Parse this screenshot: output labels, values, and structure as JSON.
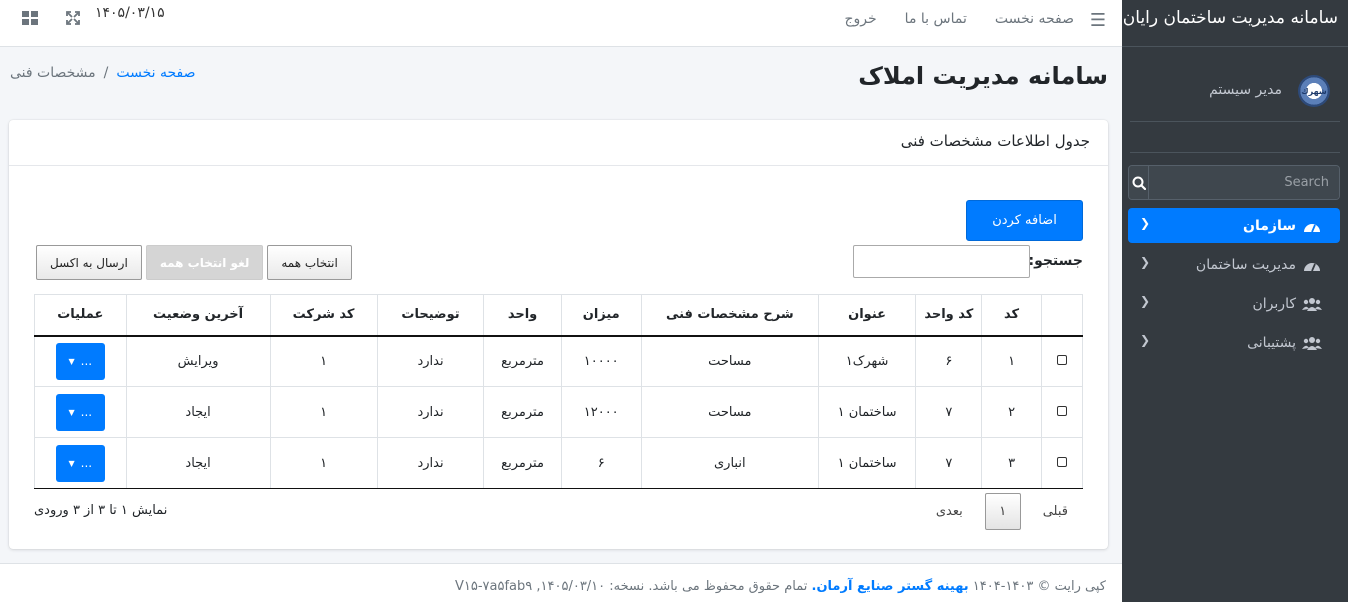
{
  "brand": {
    "title": "سامانه مدیریت ساختمان رایان"
  },
  "user": {
    "name": "مدیر سیستم",
    "avatar_text": "شهرك"
  },
  "sidebar_search": {
    "placeholder": "Search"
  },
  "nav": {
    "items": [
      {
        "label": "سازمان",
        "icon": "dashboard-icon",
        "active": true
      },
      {
        "label": "مدیریت ساختمان",
        "icon": "dashboard-icon",
        "active": false
      },
      {
        "label": "کاربران",
        "icon": "users-icon",
        "active": false
      },
      {
        "label": "پشتیبانی",
        "icon": "users-icon",
        "active": false
      }
    ]
  },
  "topbar": {
    "home": "صفحه نخست",
    "contact": "تماس با ما",
    "logout": "خروج",
    "date": "۱۴۰۵/۰۳/۱۵"
  },
  "page": {
    "title": "سامانه مدیریت املاک",
    "breadcrumb_home": "صفحه نخست",
    "breadcrumb_sep": "/",
    "breadcrumb_current": "مشخصات فنی"
  },
  "card": {
    "title": "جدول اطلاعات مشخصات فنی",
    "add_label": "اضافه کردن",
    "search_label": "جستجو:",
    "buttons": {
      "select_all": "انتخاب همه",
      "deselect_all": "لغو انتخاب همه",
      "excel": "ارسال به اکسل"
    }
  },
  "table": {
    "headers": [
      "",
      "کد",
      "کد واحد",
      "عنوان",
      "شرح مشخصات فنی",
      "میزان",
      "واحد",
      "توضیحات",
      "کد شرکت",
      "آخرین وضعیت",
      "عملیات"
    ],
    "rows": [
      [
        "۱",
        "۶",
        "شهرک۱",
        "مساحت",
        "۱۰۰۰۰",
        "مترمربع",
        "ندارد",
        "۱",
        "ویرایش"
      ],
      [
        "۲",
        "۷",
        "ساختمان ۱",
        "مساحت",
        "۱۲۰۰۰",
        "مترمربع",
        "ندارد",
        "۱",
        "ایجاد"
      ],
      [
        "۳",
        "۷",
        "ساختمان ۱",
        "انباری",
        "۶",
        "مترمربع",
        "ندارد",
        "۱",
        "ایجاد"
      ]
    ],
    "ops_label": "..."
  },
  "pagination": {
    "prev": "قبلی",
    "page": "۱",
    "next": "بعدی",
    "info": "نمایش ۱ تا ۳ از ۳ ورودی"
  },
  "footer": {
    "prefix": "کپی رایت © ۱۴۰۳-۱۴۰۴",
    "company": "بهینه گستر صنایع آرمان.",
    "suffix": "تمام حقوق محفوظ می باشد. نسخه: ۱۴۰۵/۰۳/۱۰, V۱۵-۷a۵fab۹"
  },
  "colors": {
    "primary": "#007bff",
    "sidebar": "#343a40"
  }
}
